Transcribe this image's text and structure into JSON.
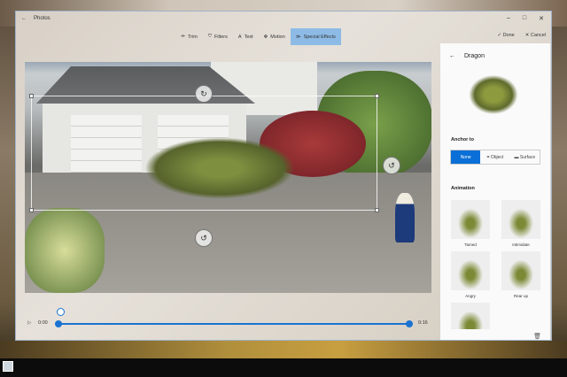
{
  "window": {
    "title": "Photos",
    "back": "←",
    "minimize": "–",
    "maximize": "□",
    "close": "✕"
  },
  "toolbar": {
    "tools": [
      {
        "label": "Trim",
        "icon": "⟛"
      },
      {
        "label": "Filters",
        "icon": "⛉"
      },
      {
        "label": "Text",
        "icon": "A"
      },
      {
        "label": "Motion",
        "icon": "✥"
      },
      {
        "label": "Special Effects",
        "icon": "≫"
      }
    ],
    "active": "Special Effects",
    "done": "Done",
    "cancel": "Cancel",
    "done_icon": "✓",
    "cancel_icon": "✕"
  },
  "timeline": {
    "play_icon": "▷",
    "start": "0:00",
    "end": "0:16",
    "position": 0.0
  },
  "panel": {
    "back": "←",
    "title": "Dragon",
    "anchor_heading": "Anchor to",
    "anchor_options": [
      "None",
      "Object",
      "Surface"
    ],
    "anchor_selected": "None",
    "animation_heading": "Animation",
    "animations": [
      "Tamed",
      "Intimidate",
      "Angry",
      "Rear up",
      ""
    ],
    "trash_icon": "🗑"
  }
}
